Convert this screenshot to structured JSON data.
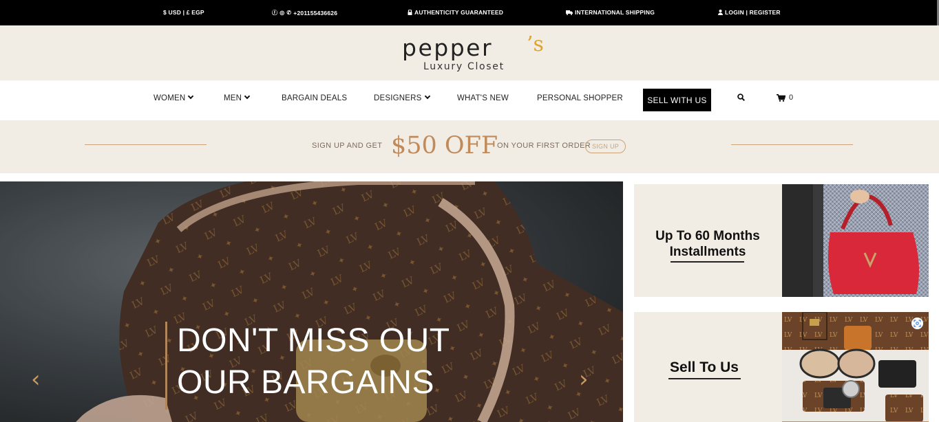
{
  "topbar": {
    "currency": "$ USD | £ EGP",
    "phone": "+201155436626",
    "authenticity": "AUTHENTICITY GUARANTEED",
    "shipping": "INTERNATIONAL SHIPPING",
    "login": "LOGIN | REGISTER"
  },
  "logo": {
    "word": "pepper",
    "accent_s": "’s",
    "subtitle": "Luxury Closet",
    "accent_color": "#e0a42a"
  },
  "nav": {
    "items": [
      {
        "label": "WOMEN",
        "dropdown": true
      },
      {
        "label": "MEN",
        "dropdown": true
      },
      {
        "label": "BARGAIN DEALS",
        "dropdown": false
      },
      {
        "label": "DESIGNERS",
        "dropdown": true
      },
      {
        "label": "WHAT'S NEW",
        "dropdown": false
      },
      {
        "label": "PERSONAL SHOPPER",
        "dropdown": false
      }
    ],
    "sell_button": "SELL WITH US",
    "cart_count": "0"
  },
  "promo": {
    "lead": "SIGN UP AND GET",
    "amount": "$50 OFF",
    "tail": "ON YOUR FIRST ORDER",
    "button": "SIGN UP"
  },
  "hero": {
    "line1": "DON'T MISS OUT",
    "line2": "OUR BARGAINS",
    "prev_glyph": "‹",
    "next_glyph": "›"
  },
  "cards": {
    "installments": {
      "line1": "Up To 60 Months",
      "line2": "Installments"
    },
    "sell": {
      "label": "Sell To Us"
    }
  },
  "colors": {
    "accent_gold": "#c08a5a",
    "cream": "#f2ede4",
    "black": "#000000"
  }
}
